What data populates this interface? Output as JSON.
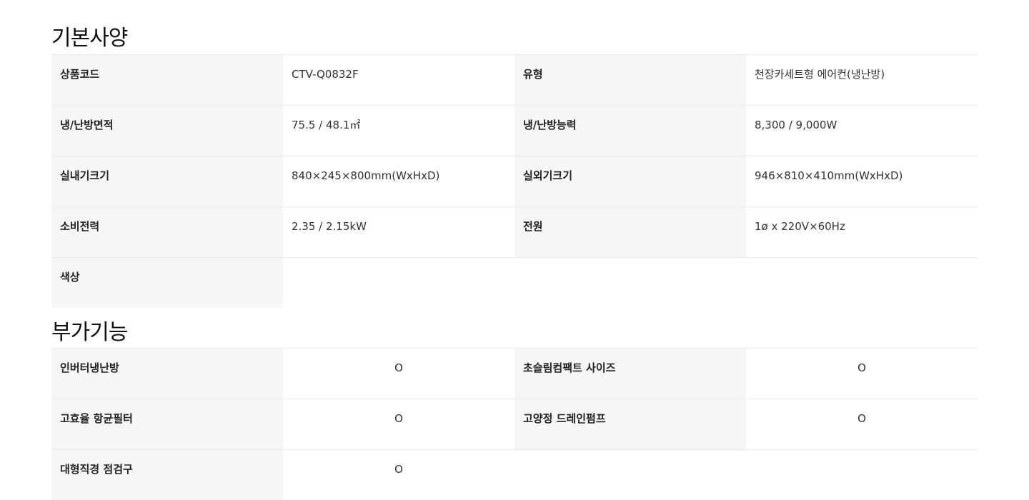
{
  "basic_specs": {
    "title": "기본사양",
    "rows": [
      {
        "k1": "상품코드",
        "v1": "CTV-Q0832F",
        "k2": "유형",
        "v2": "천장카세트형 에어컨(냉난방)"
      },
      {
        "k1": "냉/난방면적",
        "v1": "75.5 / 48.1㎡",
        "k2": "냉/난방능력",
        "v2": "8,300 / 9,000W"
      },
      {
        "k1": "실내기크기",
        "v1": "840×245×800mm(WxHxD)",
        "k2": "실외기크기",
        "v2": "946×810×410mm(WxHxD)"
      },
      {
        "k1": "소비전력",
        "v1": "2.35 / 2.15kW",
        "k2": "전원",
        "v2": "1ø x 220V×60Hz"
      },
      {
        "k1": "색상",
        "v1": ""
      }
    ]
  },
  "extra_features": {
    "title": "부가기능",
    "rows": [
      {
        "k1": "인버터냉난방",
        "v1": "O",
        "k2": "초슬림컴팩트 사이즈",
        "v2": "O"
      },
      {
        "k1": "고효율 항균필터",
        "v1": "O",
        "k2": "고양정 드레인펌프",
        "v2": "O"
      },
      {
        "k1": "대형직경 점검구",
        "v1": "O"
      }
    ]
  }
}
